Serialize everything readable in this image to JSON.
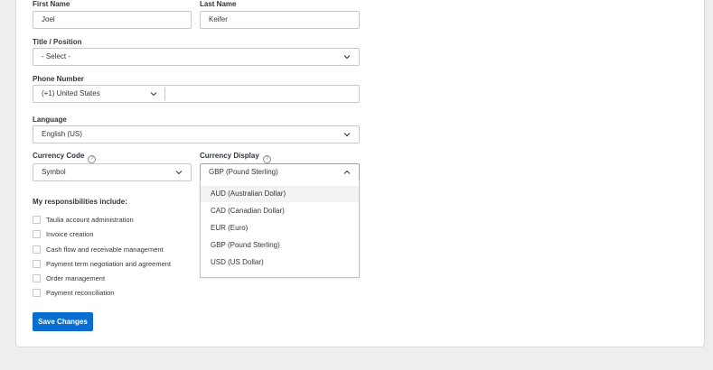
{
  "form": {
    "first_name": {
      "label": "First Name",
      "value": "Joel"
    },
    "last_name": {
      "label": "Last Name",
      "value": "Keifer"
    },
    "title_position": {
      "label": "Title / Position",
      "value": "- Select -"
    },
    "phone": {
      "label": "Phone Number",
      "country": "(+1) United States",
      "number": ""
    },
    "language": {
      "label": "Language",
      "value": "English (US)"
    },
    "currency_code": {
      "label": "Currency Code",
      "value": "Symbol",
      "help_icon": "question-circle-icon"
    },
    "currency_display": {
      "label": "Currency Display",
      "value": "GBP (Pound Sterling)",
      "help_icon": "question-circle-icon",
      "expanded": true,
      "options": [
        "AUD (Australian Dollar)",
        "CAD (Canadian Dollar)",
        "EUR (Euro)",
        "GBP (Pound Sterling)",
        "USD (US Dollar)"
      ],
      "hovered_index": 0
    },
    "responsibilities": {
      "heading": "My responsibilities include:",
      "items": [
        {
          "label": "Taulia account administration",
          "checked": false
        },
        {
          "label": "Invoice creation",
          "checked": false
        },
        {
          "label": "Cash flow and receivable management",
          "checked": false
        },
        {
          "label": "Payment term negotiation and agreement",
          "checked": false
        },
        {
          "label": "Order management",
          "checked": false
        },
        {
          "label": "Payment reconciliation",
          "checked": false
        }
      ]
    },
    "save_label": "Save Changes"
  },
  "colors": {
    "accent": "#0a6ed1",
    "page_bg": "#eceef0",
    "field_border": "#c7cacd",
    "focus_border": "#8fa7c2"
  }
}
